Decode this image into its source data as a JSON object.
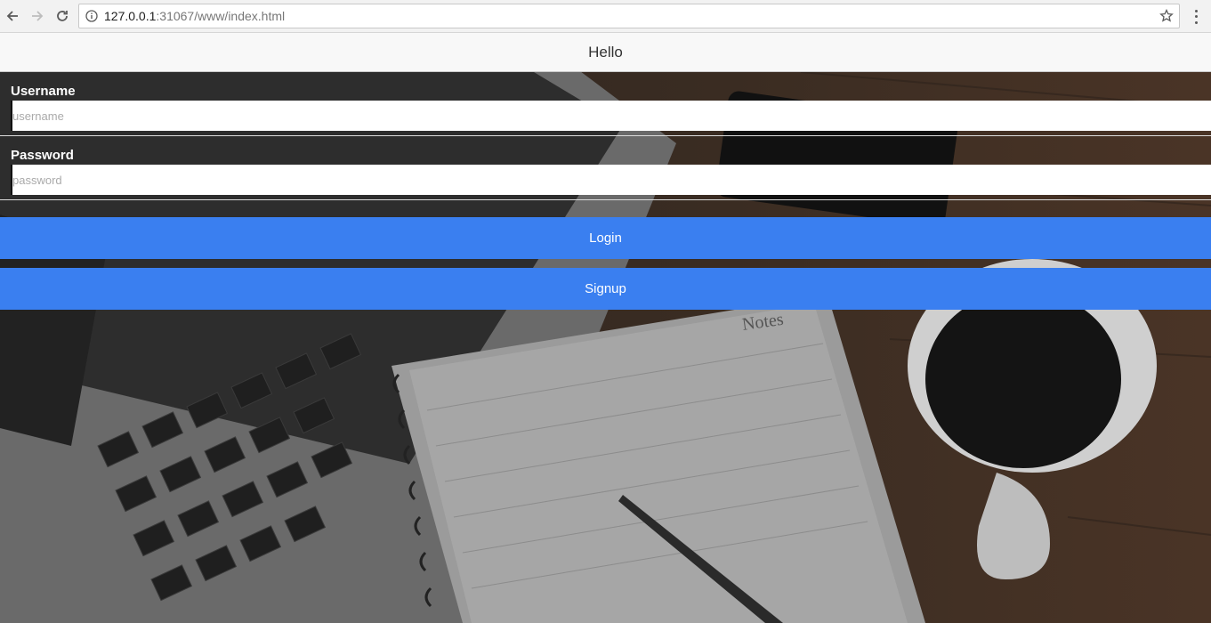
{
  "browser": {
    "url_host": "127.0.0.1",
    "url_rest": ":31067/www/index.html"
  },
  "header": {
    "title": "Hello"
  },
  "form": {
    "username_label": "Username",
    "username_placeholder": "username",
    "password_label": "Password",
    "password_placeholder": "password"
  },
  "buttons": {
    "login_label": "Login",
    "signup_label": "Signup"
  },
  "colors": {
    "accent": "#3a7ff0",
    "header_bg": "#f8f8f8"
  },
  "background_decor": {
    "notebook_heading": "Notes"
  }
}
